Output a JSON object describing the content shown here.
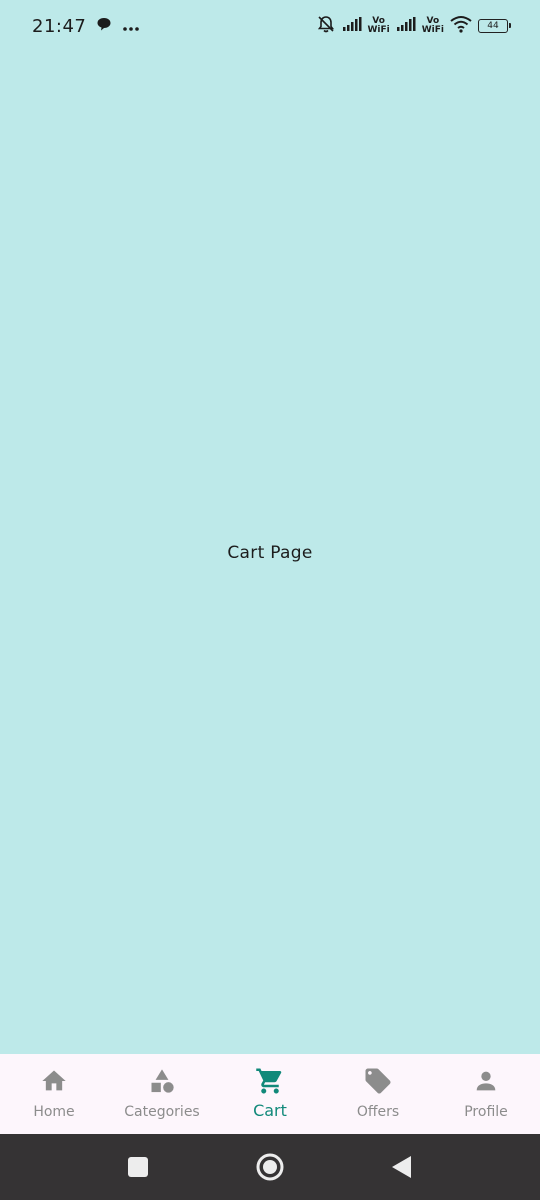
{
  "status_bar": {
    "time": "21:47",
    "vowifi_1_top": "Vo",
    "vowifi_1_bottom": "WiFi",
    "vowifi_2_top": "Vo",
    "vowifi_2_bottom": "WiFi",
    "battery_level": "44",
    "icons": [
      "message-bubble-icon",
      "more-dots-icon",
      "bell-off-icon",
      "signal-icon",
      "signal-icon",
      "wifi-icon",
      "battery-icon"
    ]
  },
  "main": {
    "page_text": "Cart Page"
  },
  "bottom_nav": {
    "items": [
      {
        "label": "Home",
        "icon": "home-icon",
        "active": false
      },
      {
        "label": "Categories",
        "icon": "categories-icon",
        "active": false
      },
      {
        "label": "Cart",
        "icon": "cart-icon",
        "active": true
      },
      {
        "label": "Offers",
        "icon": "tag-icon",
        "active": false
      },
      {
        "label": "Profile",
        "icon": "person-icon",
        "active": false
      }
    ],
    "active_color": "#11897a",
    "inactive_color": "#8c8c8c"
  },
  "colors": {
    "page_background": "#bde9e9",
    "nav_background": "#fdf6fc",
    "system_nav_background": "#353334"
  },
  "system_nav": {
    "buttons": [
      "recents-square-icon",
      "home-circle-icon",
      "back-triangle-icon"
    ]
  }
}
